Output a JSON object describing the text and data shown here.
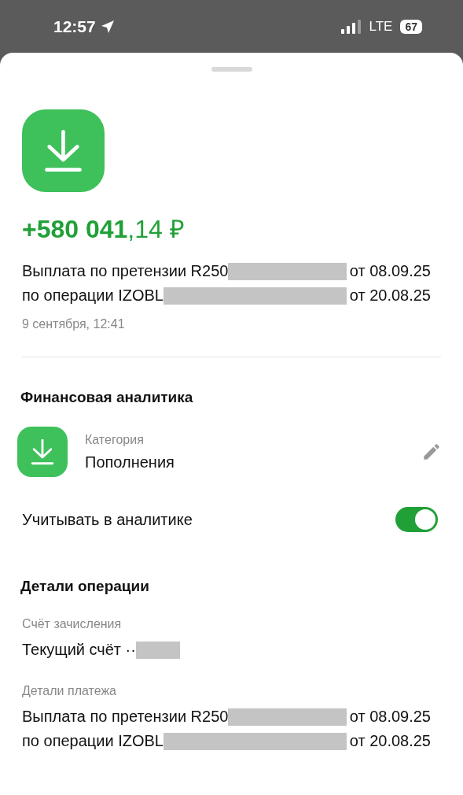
{
  "status_bar": {
    "time": "12:57",
    "network": "LTE",
    "battery": "67"
  },
  "operation": {
    "amount_main": "+580 041",
    "amount_fraction": ",14 ₽",
    "description": [
      [
        {
          "kind": "text",
          "text": "Выплата по претензии R250"
        },
        {
          "kind": "redaction"
        },
        {
          "kind": "text",
          "text": "от 08.09.25"
        }
      ],
      [
        {
          "kind": "text",
          "text": "по операции IZOBL"
        },
        {
          "kind": "redaction"
        },
        {
          "kind": "text",
          "text": "от 20.08.25"
        }
      ]
    ],
    "date": "9 сентября, 12:41"
  },
  "analytics": {
    "title": "Финансовая аналитика",
    "category_label": "Категория",
    "category_value": "Пополнения",
    "toggle_label": "Учитывать в аналитике",
    "toggle_on": true
  },
  "details": {
    "title": "Детали операции",
    "fields": [
      {
        "label": "Счёт зачисления",
        "lines": [
          [
            {
              "kind": "text",
              "text": "Текущий счёт ··"
            },
            {
              "kind": "redaction"
            }
          ]
        ]
      },
      {
        "label": "Детали платежа",
        "lines": [
          [
            {
              "kind": "text",
              "text": "Выплата по претензии R250"
            },
            {
              "kind": "redaction"
            },
            {
              "kind": "text",
              "text": "от 08.09.25"
            }
          ],
          [
            {
              "kind": "text",
              "text": "по операции IZOBL"
            },
            {
              "kind": "redaction"
            },
            {
              "kind": "text",
              "text": "от 20.08.25"
            }
          ]
        ]
      }
    ]
  }
}
